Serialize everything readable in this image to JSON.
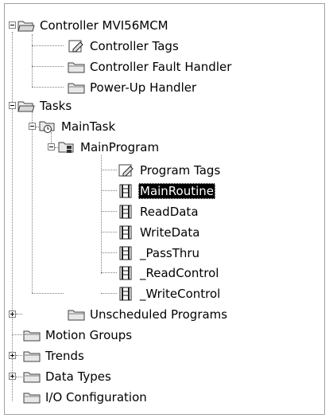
{
  "tree": {
    "controller": {
      "label": "Controller MVI56MCM",
      "expanded": true
    },
    "controller_tags": {
      "label": "Controller Tags"
    },
    "controller_fault_handler": {
      "label": "Controller Fault Handler"
    },
    "power_up_handler": {
      "label": "Power-Up Handler"
    },
    "tasks": {
      "label": "Tasks",
      "expanded": true
    },
    "main_task": {
      "label": "MainTask",
      "expanded": true
    },
    "main_program": {
      "label": "MainProgram",
      "expanded": true
    },
    "program_tags": {
      "label": "Program Tags"
    },
    "routines": [
      {
        "label": "MainRoutine",
        "selected": true
      },
      {
        "label": "ReadData"
      },
      {
        "label": "WriteData"
      },
      {
        "label": "_PassThru"
      },
      {
        "label": "_ReadControl"
      },
      {
        "label": "_WriteControl"
      }
    ],
    "unscheduled_programs": {
      "label": "Unscheduled Programs"
    },
    "motion_groups": {
      "label": "Motion Groups",
      "expanded": false
    },
    "trends": {
      "label": "Trends"
    },
    "data_types": {
      "label": "Data Types",
      "expanded": false
    },
    "io_configuration": {
      "label": "I/O Configuration",
      "expanded": false
    }
  },
  "icons": {
    "folder": "folder-icon",
    "folder_open": "folder-open-icon",
    "tags": "tags-icon",
    "task": "task-icon",
    "program": "program-icon",
    "routine": "ladder-routine-icon"
  },
  "colors": {
    "selection_bg": "#000000",
    "selection_fg": "#ffffff",
    "connector": "#808080",
    "border": "#a0a0a0"
  }
}
